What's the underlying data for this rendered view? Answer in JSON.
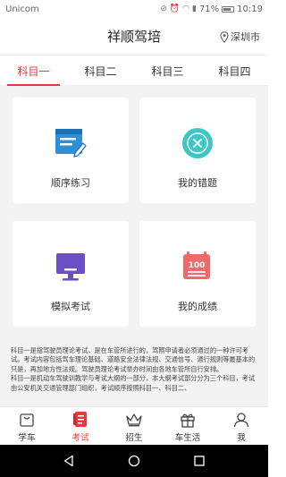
{
  "status_bar": {
    "carrier": "Unicom",
    "battery": "71%",
    "time": "10:19"
  },
  "header": {
    "title": "祥顺驾培",
    "city": "深圳市"
  },
  "tabs": [
    {
      "label": "科目一",
      "active": true
    },
    {
      "label": "科目二"
    },
    {
      "label": "科目三"
    },
    {
      "label": "科目四"
    }
  ],
  "cards": [
    {
      "label": "顺序练习",
      "icon": "practice-icon"
    },
    {
      "label": "我的错题",
      "icon": "wrong-answers-icon"
    },
    {
      "label": "模拟考试",
      "icon": "exam-monitor-icon"
    },
    {
      "label": "我的成绩",
      "icon": "score-100-icon",
      "icon_text": "100"
    }
  ],
  "description": "科目一是指驾驶员理论考试，是在车管所进行的，驾照申请者必须通过的一种许可考试。考试内容包括驾车理论基础、道路安全法律法规、交通信号、通行规则等最基本的只是，再加地方性法规。驾驶员理论考试举办时间由各地车管所自行安排。\n科目一是机动车驾驶训教学与考试大纲的一部分，本大纲考试部分分为三个科目，考试由公安机关交通管理部门组织，考试顺序按照科目一、科目二、",
  "bottom_nav": [
    {
      "label": "学车",
      "icon": "bag-icon"
    },
    {
      "label": "考试",
      "icon": "exam-icon",
      "active": true
    },
    {
      "label": "招生",
      "icon": "crown-icon"
    },
    {
      "label": "车生活",
      "icon": "gift-icon"
    },
    {
      "label": "我",
      "icon": "person-icon"
    }
  ],
  "colors": {
    "accent": "#e8383d",
    "practice_blue": "#2d8fd6",
    "wrong_teal": "#3cc7c6",
    "exam_purple": "#6c4fc5",
    "score_red": "#f06a6a"
  }
}
